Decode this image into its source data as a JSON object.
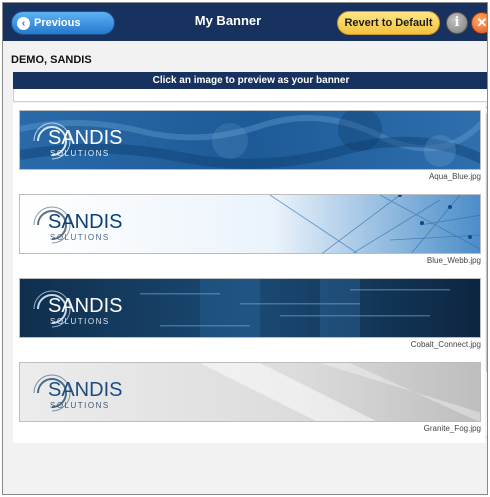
{
  "header": {
    "previous_label": "Previous",
    "title": "My Banner",
    "revert_label": "Revert to Default",
    "info_glyph": "i",
    "close_glyph": "✕"
  },
  "user": {
    "name": "DEMO, SANDIS"
  },
  "instruction": "Click an image to preview as your banner",
  "banners": [
    {
      "file": "Aqua_Blue.jpg",
      "logo": "SANDIS",
      "sub": "SOLUTIONS"
    },
    {
      "file": "Blue_Webb.jpg",
      "logo": "SANDIS",
      "sub": "SOLUTIONS"
    },
    {
      "file": "Cobalt_Connect.jpg",
      "logo": "SANDIS",
      "sub": "SOLUTIONS"
    },
    {
      "file": "Granite_Fog.jpg",
      "logo": "SANDIS",
      "sub": "SOLUTIONS"
    }
  ],
  "colors": {
    "header_bg": "#17325f",
    "accent_blue": "#2878cc",
    "accent_yellow": "#f2c33e",
    "accent_orange": "#e0521a"
  }
}
